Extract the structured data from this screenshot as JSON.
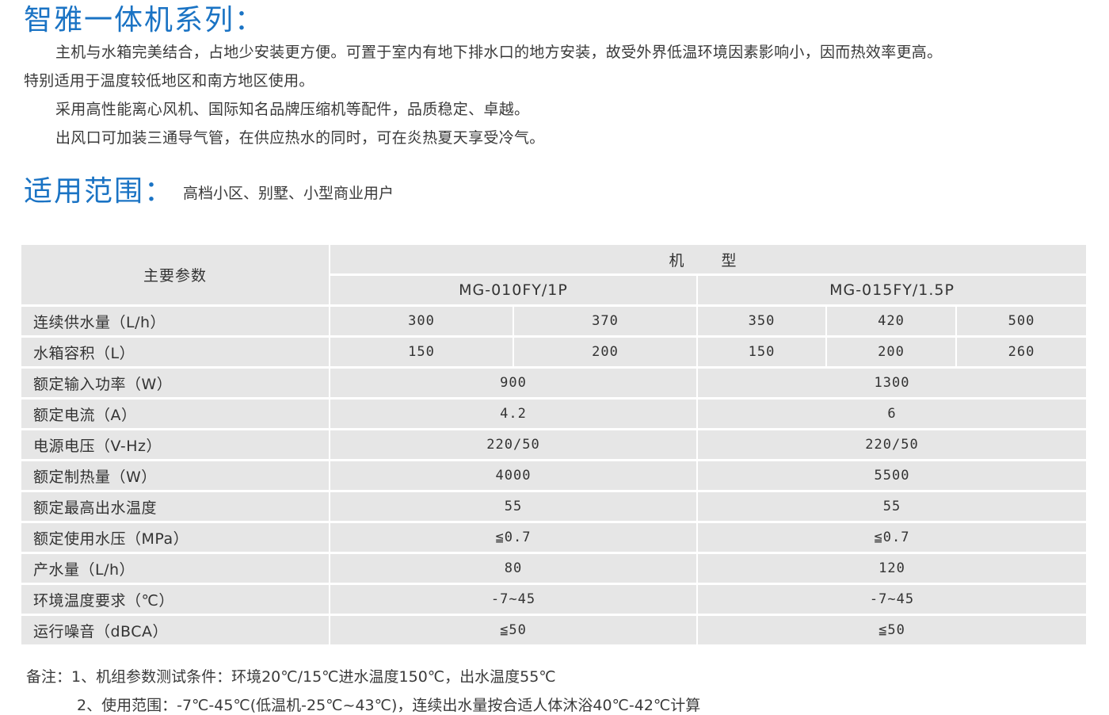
{
  "heading1": "智雅一体机系列：",
  "intro": [
    "主机与水箱完美结合，占地少安装更方便。可置于室内有地下排水口的地方安装，故受外界低温环境因素影响小，因而热效率更高。",
    "特别适用于温度较低地区和南方地区使用。",
    "采用高性能离心风机、国际知名品牌压缩机等配件，品质稳定、卓越。",
    "出风口可加装三通导气管，在供应热水的同时，可在炎热夏天享受冷气。"
  ],
  "heading2": "适用范围：",
  "scope": "高档小区、别墅、小型商业用户",
  "table": {
    "param_header": "主要参数",
    "model_header": "机　型",
    "models": [
      "MG-010FY/1P",
      "MG-015FY/1.5P"
    ],
    "rows": [
      {
        "label": "连续供水量（L/h）",
        "m1": [
          "300",
          "370"
        ],
        "m2": [
          "350",
          "420",
          "500"
        ]
      },
      {
        "label": "水箱容积（L）",
        "m1": [
          "150",
          "200"
        ],
        "m2": [
          "150",
          "200",
          "260"
        ]
      },
      {
        "label": "额定输入功率（W）",
        "m1": "900",
        "m2": "1300"
      },
      {
        "label": "额定电流（A）",
        "m1": "4.2",
        "m2": "6"
      },
      {
        "label": "电源电压（V-Hz）",
        "m1": "220/50",
        "m2": "220/50"
      },
      {
        "label": "额定制热量（W）",
        "m1": "4000",
        "m2": "5500"
      },
      {
        "label": "额定最高出水温度",
        "m1": "55",
        "m2": "55"
      },
      {
        "label": "额定使用水压（MPa）",
        "m1": "≦0.7",
        "m2": "≦0.7"
      },
      {
        "label": "产水量（L/h）",
        "m1": "80",
        "m2": "120"
      },
      {
        "label": "环境温度要求（℃）",
        "m1": "-7~45",
        "m2": "-7~45"
      },
      {
        "label": "运行噪音（dBCA）",
        "m1": "≦50",
        "m2": "≦50"
      }
    ]
  },
  "notes": [
    "备注：1、机组参数测试条件：环境20℃/15℃进水温度150℃，出水温度55℃",
    "2、使用范围：-7℃-45℃(低温机-25℃~43℃)，连续出水量按合适人体沐浴40℃-42℃计算"
  ],
  "colors": {
    "heading": "#1a73c4",
    "table_bg": "#e6e6e6"
  }
}
